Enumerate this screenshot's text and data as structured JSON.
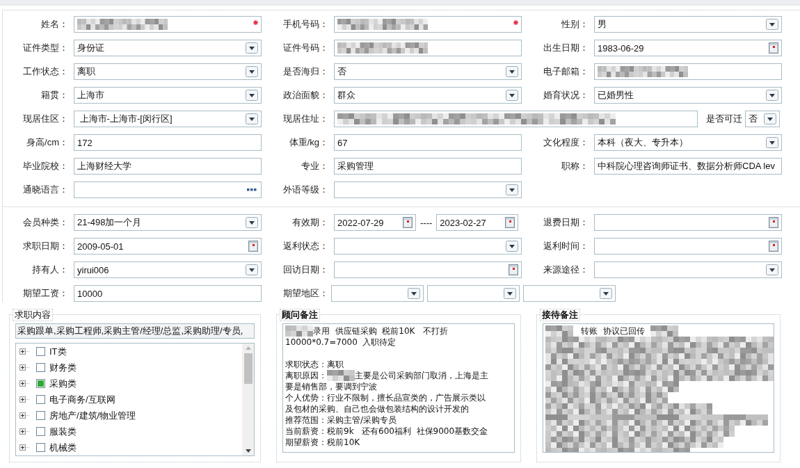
{
  "sections": [
    {
      "rows": [
        [
          {
            "label": "姓名：",
            "kind": "text",
            "masked": true,
            "required": true
          },
          {
            "label": "手机号码：",
            "kind": "text",
            "masked": true,
            "required": true
          },
          {
            "label": "性别：",
            "kind": "select",
            "value": "男"
          }
        ],
        [
          {
            "label": "证件类型：",
            "kind": "select",
            "value": "身份证"
          },
          {
            "label": "证件号码：",
            "kind": "text",
            "masked": true
          },
          {
            "label": "出生日期：",
            "kind": "date",
            "value": "1983-06-29"
          }
        ],
        [
          {
            "label": "工作状态：",
            "kind": "select",
            "value": "离职"
          },
          {
            "label": "是否海归：",
            "kind": "select",
            "value": "否"
          },
          {
            "label": "电子邮箱：",
            "kind": "text",
            "masked": true
          }
        ],
        [
          {
            "label": "籍贯：",
            "kind": "select",
            "value": "上海市"
          },
          {
            "label": "政治面貌：",
            "kind": "select",
            "value": "群众"
          },
          {
            "label": "婚育状况：",
            "kind": "select",
            "value": "已婚男性"
          }
        ],
        [
          {
            "label": "现居住区：",
            "kind": "select",
            "value": " 上海市-上海市-[闵行区]"
          },
          {
            "label": "现居住址：",
            "kind": "text",
            "masked": true,
            "extra": {
              "label": "是否可迁",
              "value": "否"
            }
          }
        ],
        [
          {
            "label": "身高/cm：",
            "kind": "text",
            "value": "172"
          },
          {
            "label": "体重/kg：",
            "kind": "text",
            "value": "67"
          },
          {
            "label": "文化程度：",
            "kind": "select",
            "value": "本科（夜大、专升本）"
          }
        ],
        [
          {
            "label": "毕业院校：",
            "kind": "text",
            "value": "上海财经大学"
          },
          {
            "label": "专业：",
            "kind": "text",
            "value": "采购管理"
          },
          {
            "label": "职称：",
            "kind": "text",
            "value": "中科院心理咨询师证书、数据分析师CDA lev"
          }
        ],
        [
          {
            "label": "通晓语言：",
            "kind": "lookup"
          },
          {
            "label": "外语等级：",
            "kind": "select"
          }
        ]
      ]
    },
    {
      "rows": [
        [
          {
            "label": "会员种类：",
            "kind": "select",
            "value": "21-498加一个月"
          },
          {
            "label": "有效期：",
            "kind": "date_range",
            "values": [
              "2022-07-29",
              "2023-02-27"
            ],
            "separator": "----"
          },
          {
            "label": "退费日期：",
            "kind": "date"
          }
        ],
        [
          {
            "label": "求职日期：",
            "kind": "date",
            "value": "2009-05-01"
          },
          {
            "label": "返利状态：",
            "kind": "select"
          },
          {
            "label": "返利时间：",
            "kind": "date"
          }
        ],
        [
          {
            "label": "持有人：",
            "kind": "select",
            "value": "yirui006"
          },
          {
            "label": "回访日期：",
            "kind": "date"
          },
          {
            "label": "来源途径：",
            "kind": "select"
          }
        ],
        [
          {
            "label": "期望工资：",
            "kind": "text",
            "value": "10000"
          },
          {
            "label": "期望地区：",
            "kind": "select_group",
            "parts": [
              {
                "kind": "select"
              },
              {
                "kind": "select"
              },
              {
                "kind": "select"
              }
            ]
          }
        ]
      ]
    }
  ],
  "job_panel": {
    "title": "求职内容",
    "bold": false,
    "summary": "采购跟单,采购工程师,采购主管/经理/总监,采购助理/专员,",
    "tree": [
      {
        "label": "IT类",
        "checked": false,
        "expanded": false
      },
      {
        "label": "财务类",
        "checked": false,
        "expanded": false
      },
      {
        "label": "采购类",
        "checked": true,
        "expanded": false
      },
      {
        "label": "电子商务/互联网",
        "checked": false,
        "expanded": false
      },
      {
        "label": "房地产/建筑/物业管理",
        "checked": false,
        "expanded": false
      },
      {
        "label": "服装类",
        "checked": false,
        "expanded": false
      },
      {
        "label": "机械类",
        "checked": false,
        "expanded": false
      }
    ]
  },
  "note_panels": [
    {
      "title": "顾问备注",
      "bold": true,
      "lines": [
        {
          "kind": "line",
          "parts": [
            {
              "kind": "mask"
            },
            {
              "kind": "text",
              "text": "录用  供应链采购  税前10K   不打折"
            }
          ]
        },
        {
          "kind": "line",
          "parts": [
            {
              "kind": "text",
              "text": "10000*0.7=7000  入职待定"
            }
          ]
        },
        {
          "kind": "blank"
        },
        {
          "kind": "line",
          "parts": [
            {
              "kind": "text",
              "text": "求职状态：离职"
            }
          ]
        },
        {
          "kind": "line",
          "parts": [
            {
              "kind": "text",
              "text": "离职原因："
            },
            {
              "kind": "mask"
            },
            {
              "kind": "text",
              "text": "主要是公司采购部门取消，上海是主"
            }
          ]
        },
        {
          "kind": "line",
          "parts": [
            {
              "kind": "text",
              "text": "要是销售部，要调到宁波"
            }
          ]
        },
        {
          "kind": "line",
          "parts": [
            {
              "kind": "text",
              "text": "个人优势：行业不限制，擅长品宣类的，广告展示类以"
            }
          ]
        },
        {
          "kind": "line",
          "parts": [
            {
              "kind": "text",
              "text": "及包材的采购、自己也会做包装结构的设计开发的"
            }
          ]
        },
        {
          "kind": "line",
          "parts": [
            {
              "kind": "text",
              "text": "推荐范围：采购主管/采购专员"
            }
          ]
        },
        {
          "kind": "line",
          "parts": [
            {
              "kind": "text",
              "text": "当前薪资：税前9k   还有600福利  社保9000基数交金"
            }
          ]
        },
        {
          "kind": "line",
          "parts": [
            {
              "kind": "text",
              "text": "期望薪资：税前10K"
            }
          ]
        }
      ]
    },
    {
      "title": "接待备注",
      "bold": true,
      "lines": [
        {
          "kind": "line",
          "parts": [
            {
              "kind": "mask"
            },
            {
              "kind": "text",
              "text": "   转账  协议已回传  "
            },
            {
              "kind": "mask"
            }
          ]
        },
        {
          "kind": "mask_block"
        }
      ]
    }
  ]
}
